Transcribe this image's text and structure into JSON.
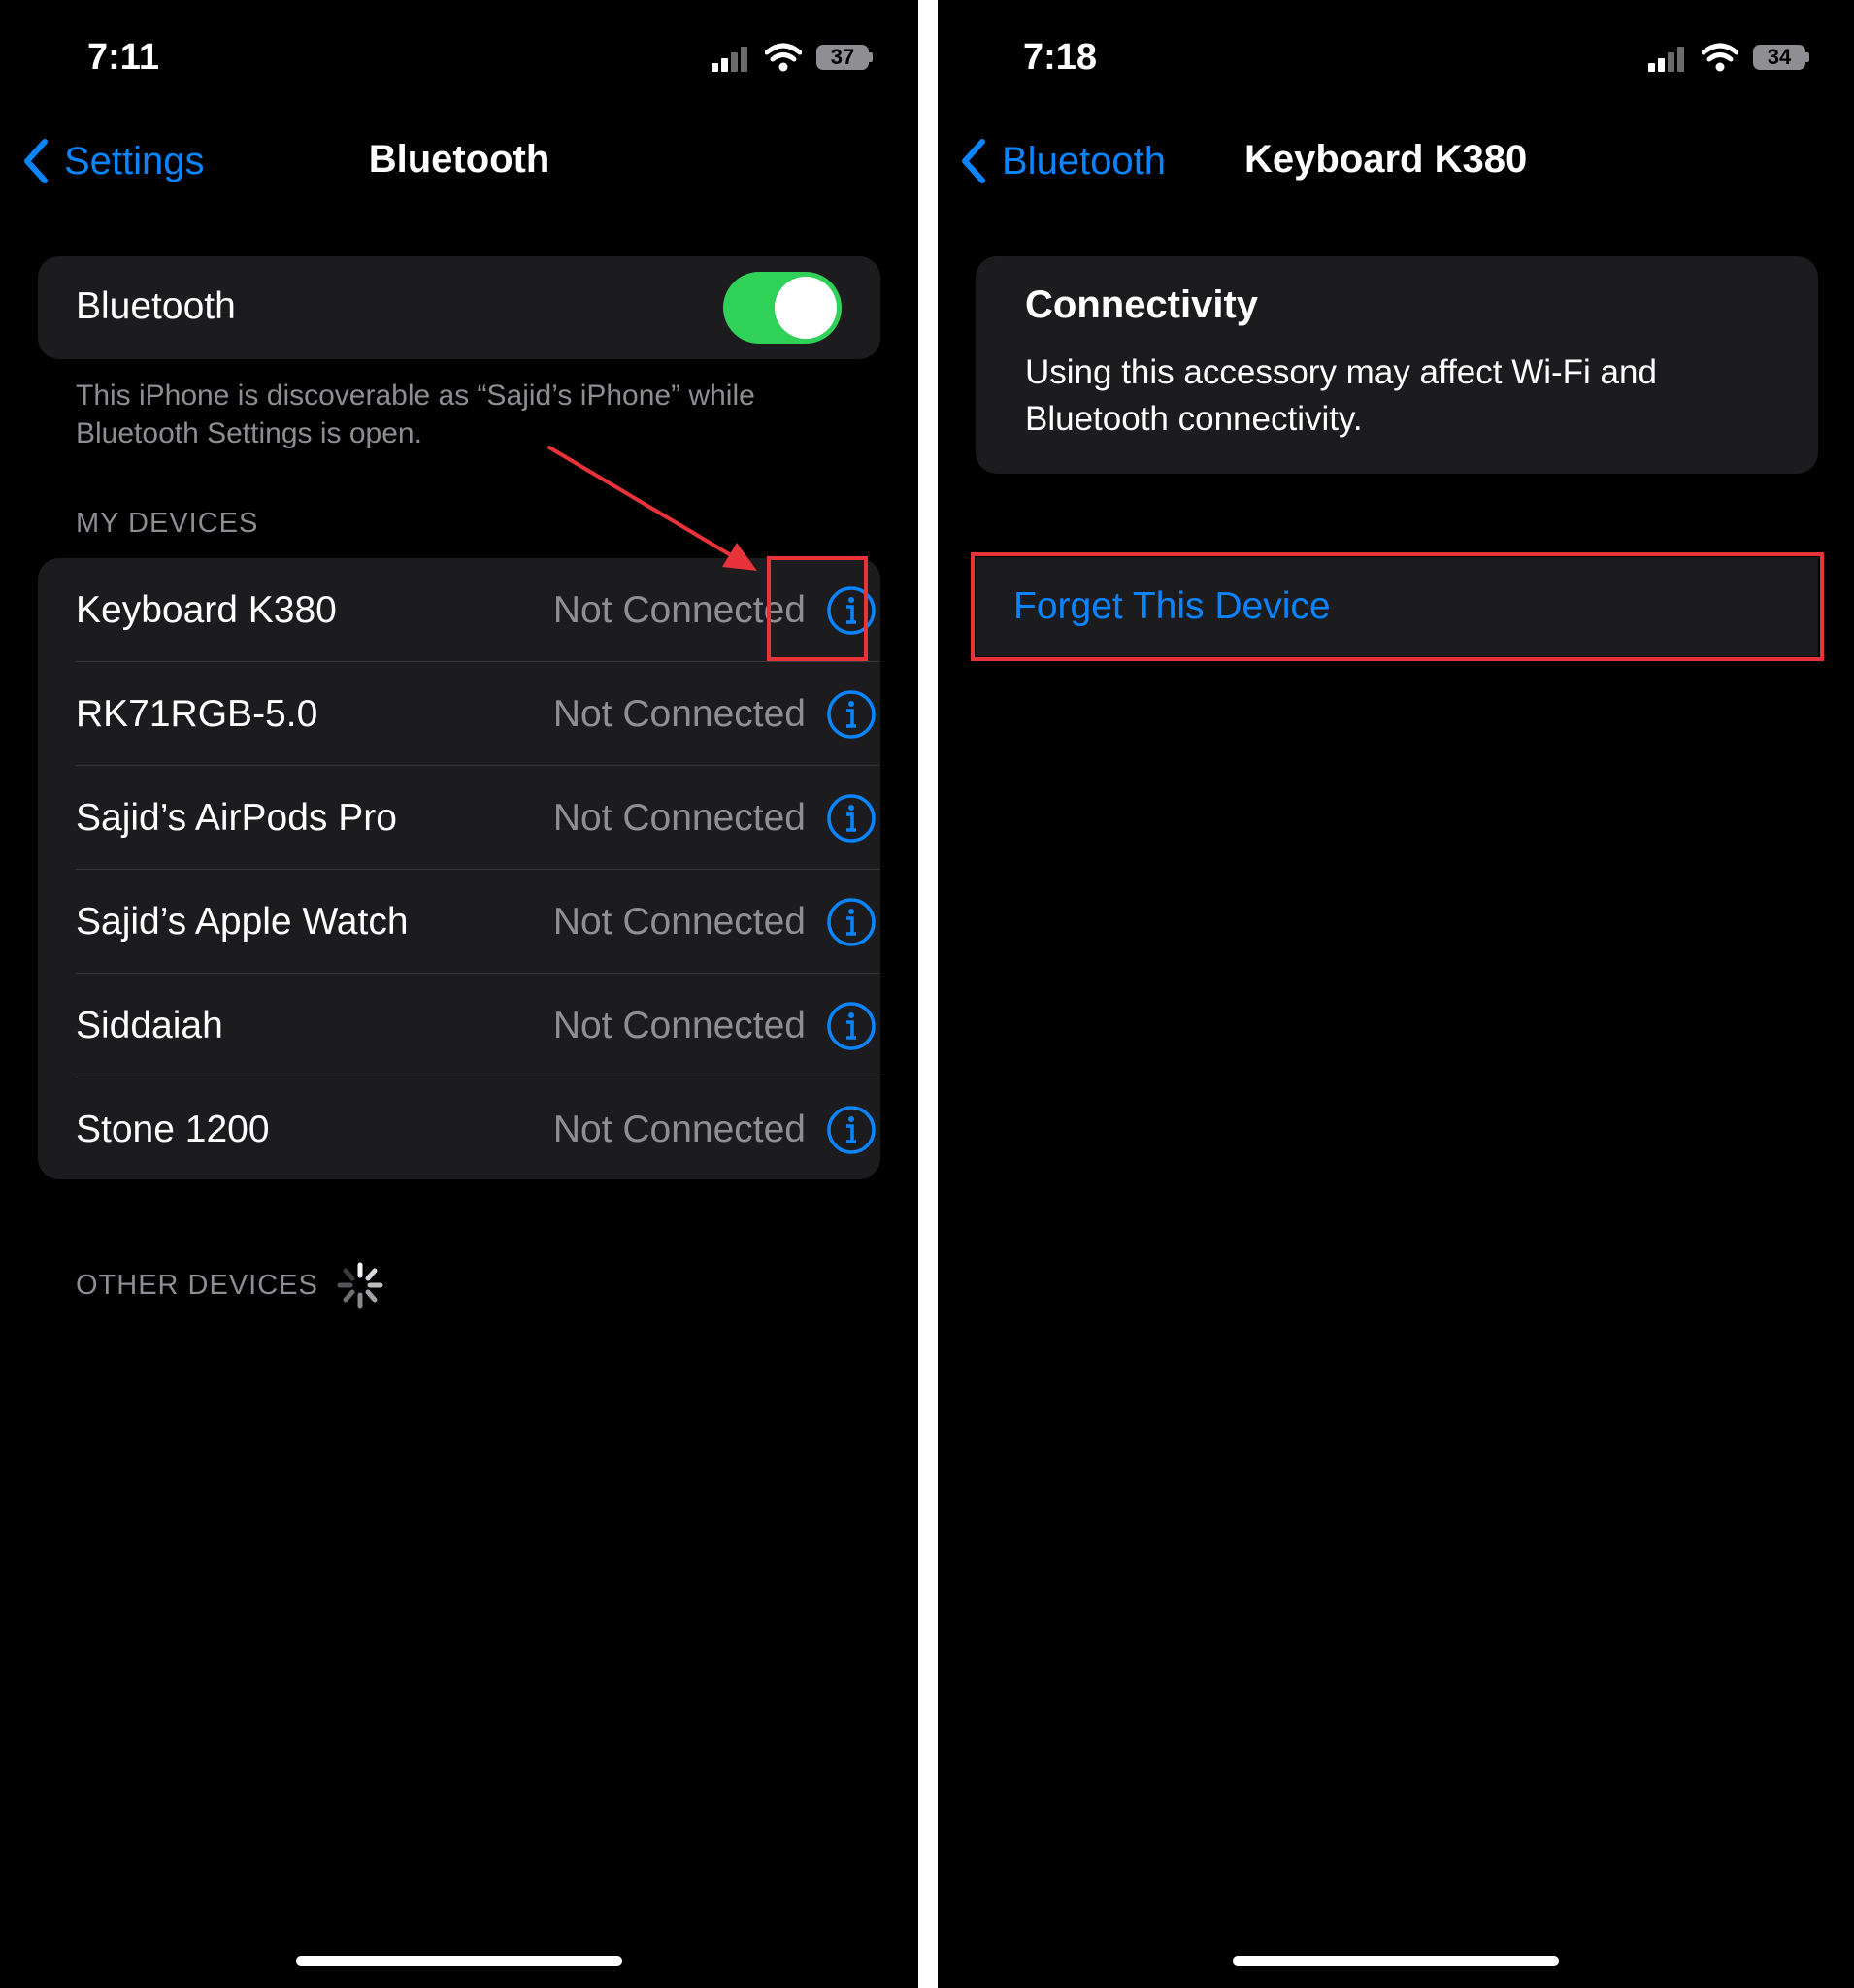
{
  "left": {
    "status_time": "7:11",
    "battery": "37",
    "back_label": "Settings",
    "title": "Bluetooth",
    "bluetooth_label": "Bluetooth",
    "bluetooth_on": true,
    "footnote": "This iPhone is discoverable as “Sajid’s iPhone” while Bluetooth Settings is open.",
    "my_devices_header": "MY DEVICES",
    "devices": [
      {
        "name": "Keyboard K380",
        "status": "Not Connected"
      },
      {
        "name": "RK71RGB-5.0",
        "status": "Not Connected"
      },
      {
        "name": "Sajid’s AirPods Pro",
        "status": "Not Connected"
      },
      {
        "name": "Sajid’s Apple Watch",
        "status": "Not Connected"
      },
      {
        "name": "Siddaiah",
        "status": "Not Connected"
      },
      {
        "name": "Stone 1200",
        "status": "Not Connected"
      }
    ],
    "other_devices_header": "OTHER DEVICES"
  },
  "right": {
    "status_time": "7:18",
    "battery": "34",
    "back_label": "Bluetooth",
    "title": "Keyboard K380",
    "connectivity_title": "Connectivity",
    "connectivity_text": "Using this accessory may affect Wi-Fi and Bluetooth connectivity.",
    "forget_label": "Forget This Device"
  },
  "colors": {
    "accent": "#0a84ff",
    "toggle_on": "#30d158",
    "annotation": "#e8333a",
    "cell_background": "#1c1c1e"
  },
  "icons": [
    "chevron-left-icon",
    "cellular-signal-icon",
    "wifi-icon",
    "battery-icon",
    "info-icon",
    "spinner-icon",
    "annotation-arrow"
  ]
}
